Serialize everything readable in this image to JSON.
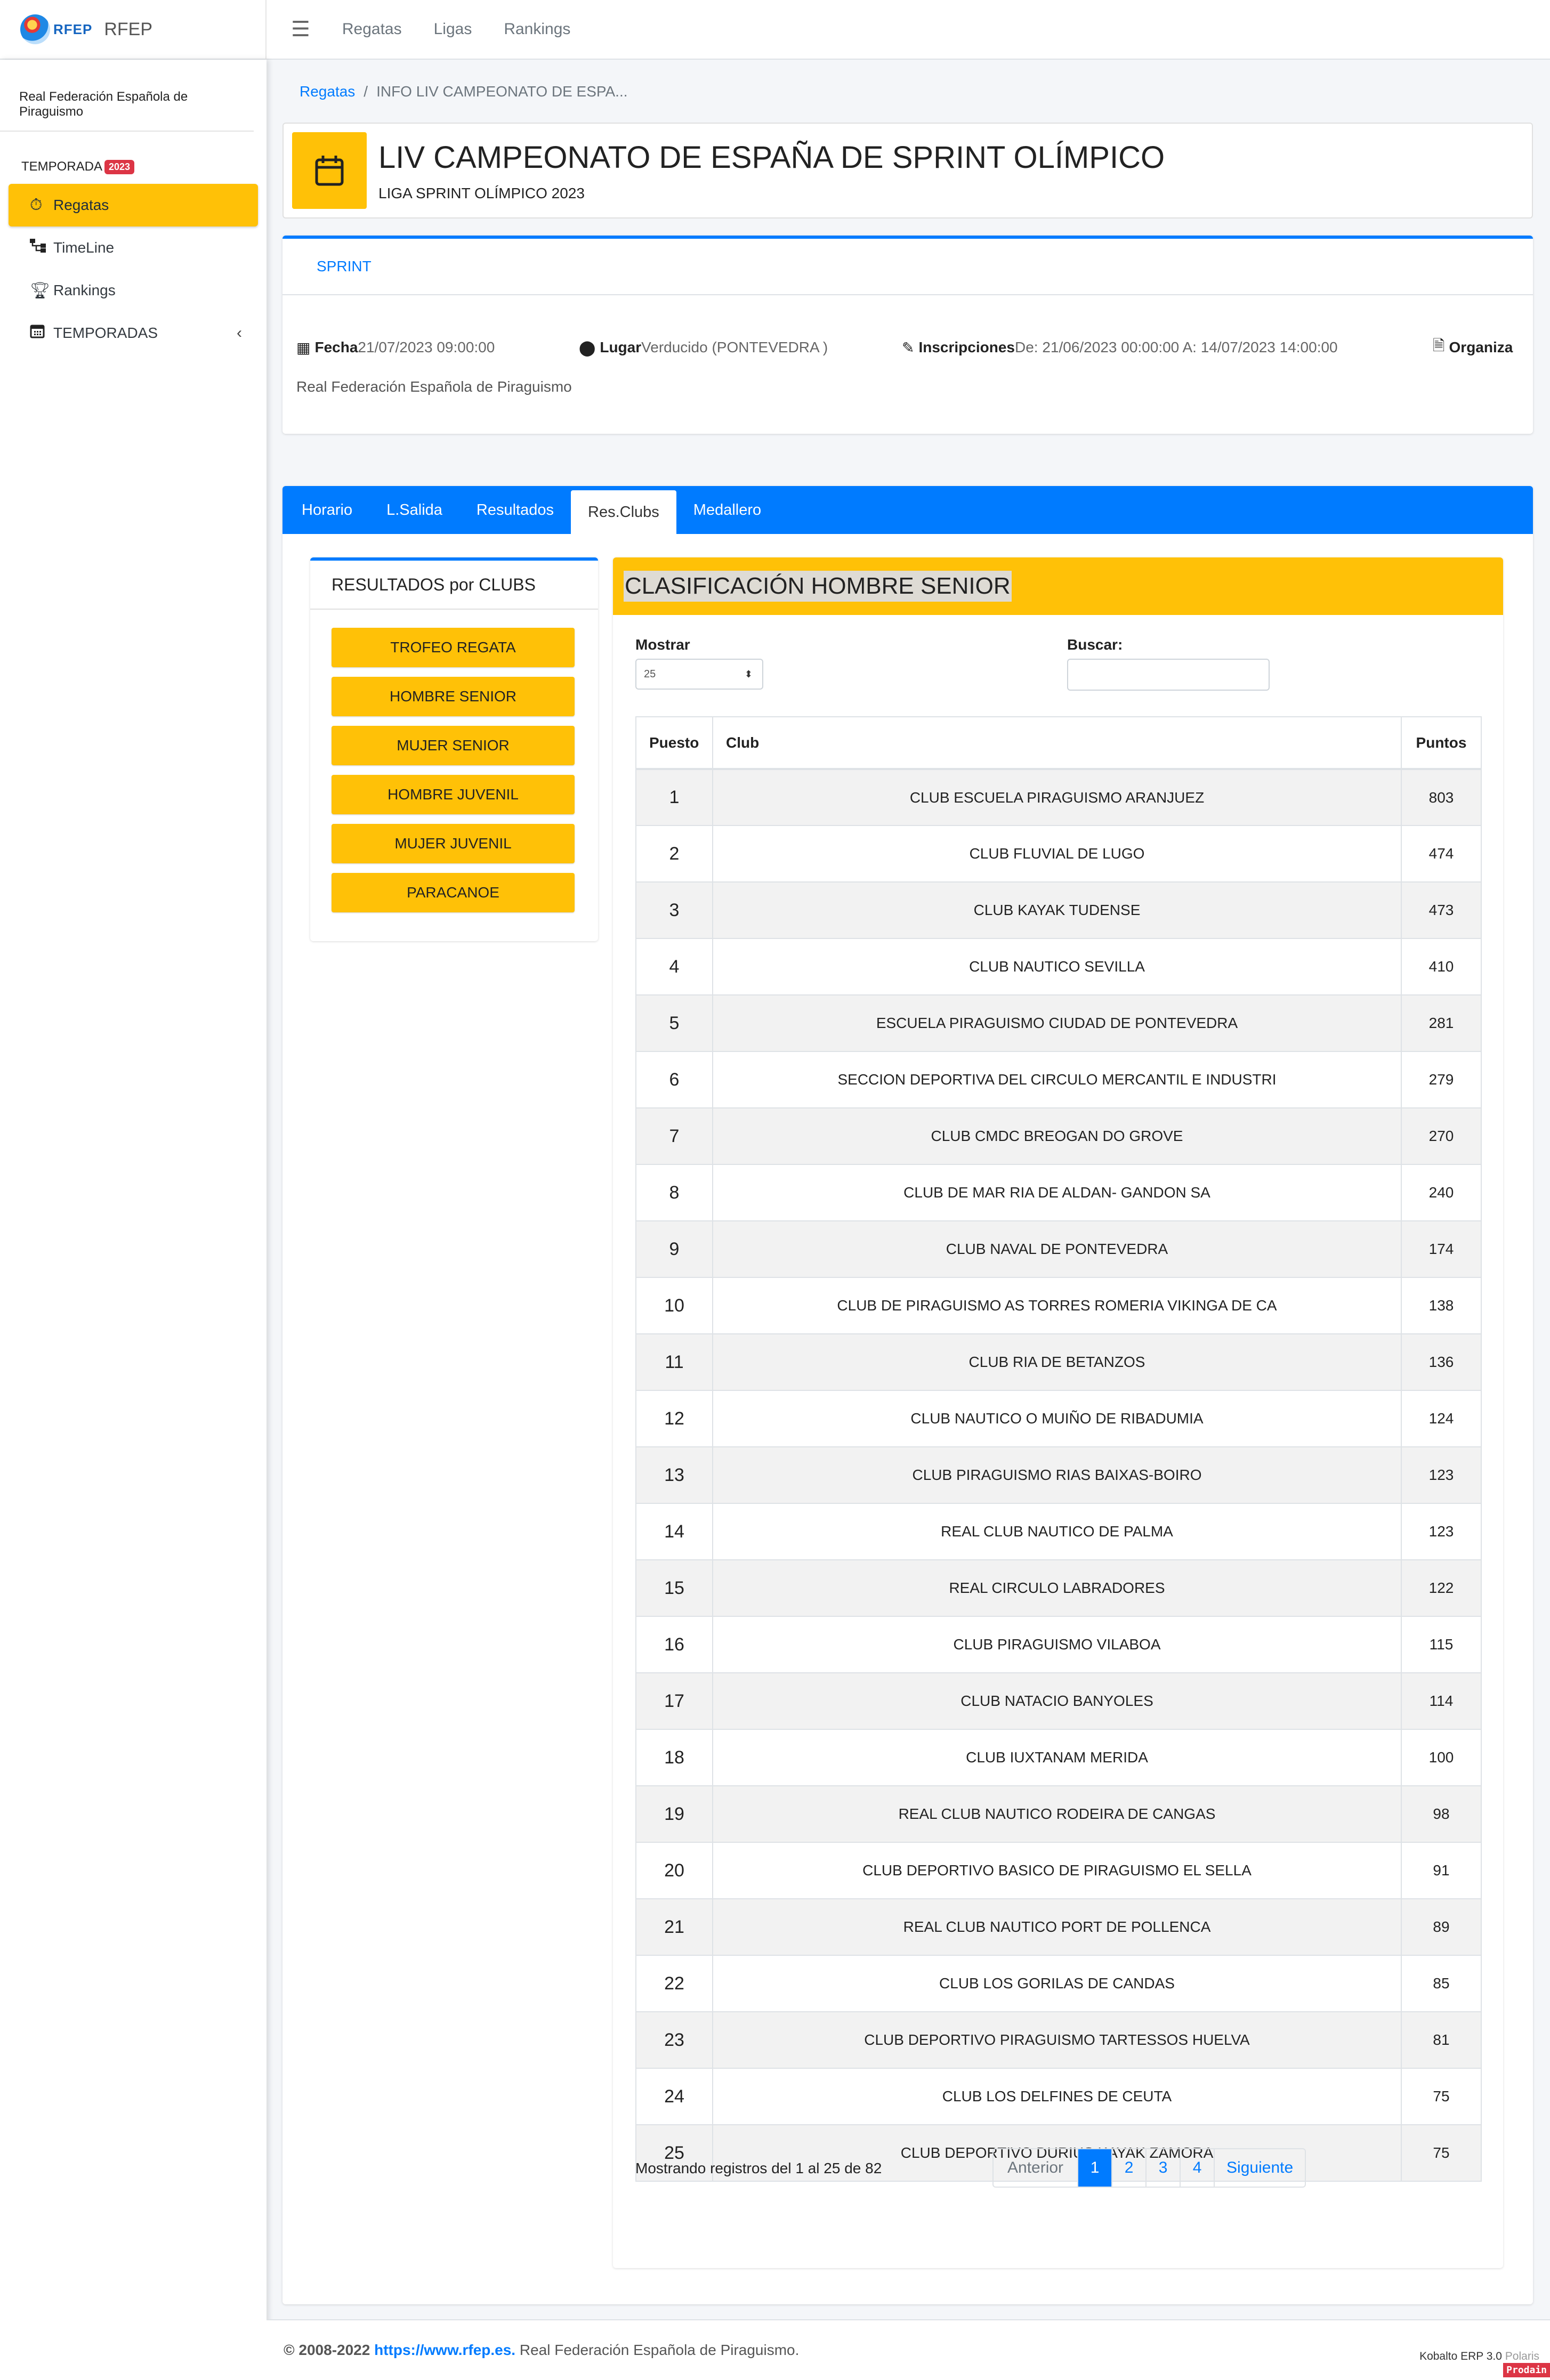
{
  "brand": {
    "abbr": "RFEP",
    "name": "RFEP"
  },
  "topnav": {
    "links": [
      "Regatas",
      "Ligas",
      "Rankings"
    ]
  },
  "sidebar": {
    "org": "Real Federación Española de Piraguismo",
    "season_label": "TEMPORADA",
    "season_badge": "2023",
    "items": [
      {
        "label": "Regatas",
        "icon": "stopwatch-icon"
      },
      {
        "label": "TimeLine",
        "icon": "sitemap-icon"
      },
      {
        "label": "Rankings",
        "icon": "trophy-icon"
      },
      {
        "label": "TEMPORADAS",
        "icon": "calendar-icon"
      }
    ]
  },
  "breadcrumb": {
    "link": "Regatas",
    "current": "INFO LIV CAMPEONATO DE ESPA..."
  },
  "event": {
    "title": "LIV CAMPEONATO DE ESPAÑA DE SPRINT OLÍMPICO",
    "subtitle": "LIGA SPRINT OLÍMPICO 2023",
    "tab": "SPRINT",
    "fecha_label": "Fecha",
    "fecha": "21/07/2023 09:00:00",
    "lugar_label": "Lugar",
    "lugar": "Verducido (PONTEVEDRA )",
    "inscripciones_label": "Inscripciones",
    "inscripciones": "De: 21/06/2023 00:00:00 A: 14/07/2023 14:00:00",
    "organiza_label": "Organiza",
    "organiza": "Real Federación Española de Piraguismo"
  },
  "tabs": [
    "Horario",
    "L.Salida",
    "Resultados",
    "Res.Clubs",
    "Medallero"
  ],
  "clubs_panel": {
    "title": "RESULTADOS por CLUBS",
    "buttons": [
      "TROFEO REGATA",
      "HOMBRE SENIOR",
      "MUJER SENIOR",
      "HOMBRE JUVENIL",
      "MUJER JUVENIL",
      "PARACANOE"
    ]
  },
  "classification": {
    "title": "CLASIFICACIÓN HOMBRE SENIOR",
    "show_label": "Mostrar",
    "show_value": "25",
    "search_label": "Buscar:",
    "headers": {
      "pos": "Puesto",
      "club": "Club",
      "pts": "Puntos"
    },
    "rows": [
      {
        "pos": "1",
        "club": "CLUB ESCUELA PIRAGUISMO ARANJUEZ",
        "pts": "803"
      },
      {
        "pos": "2",
        "club": "CLUB FLUVIAL DE LUGO",
        "pts": "474"
      },
      {
        "pos": "3",
        "club": "CLUB KAYAK TUDENSE",
        "pts": "473"
      },
      {
        "pos": "4",
        "club": "CLUB NAUTICO SEVILLA",
        "pts": "410"
      },
      {
        "pos": "5",
        "club": "ESCUELA PIRAGUISMO CIUDAD DE PONTEVEDRA",
        "pts": "281"
      },
      {
        "pos": "6",
        "club": "SECCION DEPORTIVA DEL CIRCULO MERCANTIL E INDUSTRI",
        "pts": "279"
      },
      {
        "pos": "7",
        "club": "CLUB CMDC BREOGAN DO GROVE",
        "pts": "270"
      },
      {
        "pos": "8",
        "club": "CLUB DE MAR RIA DE ALDAN- GANDON SA",
        "pts": "240"
      },
      {
        "pos": "9",
        "club": "CLUB NAVAL DE PONTEVEDRA",
        "pts": "174"
      },
      {
        "pos": "10",
        "club": "CLUB DE PIRAGUISMO AS TORRES ROMERIA VIKINGA DE CA",
        "pts": "138"
      },
      {
        "pos": "11",
        "club": "CLUB RIA DE BETANZOS",
        "pts": "136"
      },
      {
        "pos": "12",
        "club": "CLUB NAUTICO O MUIÑO DE RIBADUMIA",
        "pts": "124"
      },
      {
        "pos": "13",
        "club": "CLUB PIRAGUISMO RIAS BAIXAS-BOIRO",
        "pts": "123"
      },
      {
        "pos": "14",
        "club": "REAL CLUB NAUTICO DE PALMA",
        "pts": "123"
      },
      {
        "pos": "15",
        "club": "REAL CIRCULO LABRADORES",
        "pts": "122"
      },
      {
        "pos": "16",
        "club": "CLUB PIRAGUISMO VILABOA",
        "pts": "115"
      },
      {
        "pos": "17",
        "club": "CLUB NATACIO BANYOLES",
        "pts": "114"
      },
      {
        "pos": "18",
        "club": "CLUB IUXTANAM MERIDA",
        "pts": "100"
      },
      {
        "pos": "19",
        "club": "REAL CLUB NAUTICO RODEIRA DE CANGAS",
        "pts": "98"
      },
      {
        "pos": "20",
        "club": "CLUB DEPORTIVO BASICO DE PIRAGUISMO EL SELLA",
        "pts": "91"
      },
      {
        "pos": "21",
        "club": "REAL CLUB NAUTICO PORT DE POLLENCA",
        "pts": "89"
      },
      {
        "pos": "22",
        "club": "CLUB LOS GORILAS DE CANDAS",
        "pts": "85"
      },
      {
        "pos": "23",
        "club": "CLUB DEPORTIVO PIRAGUISMO TARTESSOS HUELVA",
        "pts": "81"
      },
      {
        "pos": "24",
        "club": "CLUB LOS DELFINES DE CEUTA",
        "pts": "75"
      },
      {
        "pos": "25",
        "club": "CLUB DEPORTIVO DURIUS KAYAK ZAMORA",
        "pts": "75"
      }
    ],
    "info": "Mostrando registros del 1 al 25 de 82",
    "pager": {
      "prev": "Anterior",
      "pages": [
        "1",
        "2",
        "3",
        "4"
      ],
      "next": "Siguiente"
    }
  },
  "footer": {
    "copy_prefix": "© 2008-2022",
    "link": "https://www.rfep.es.",
    "org": "Real Federación Española de Piraguismo.",
    "version": "Kobalto ERP 3.0",
    "polaris": "Polaris",
    "prodain": "Prodain"
  }
}
